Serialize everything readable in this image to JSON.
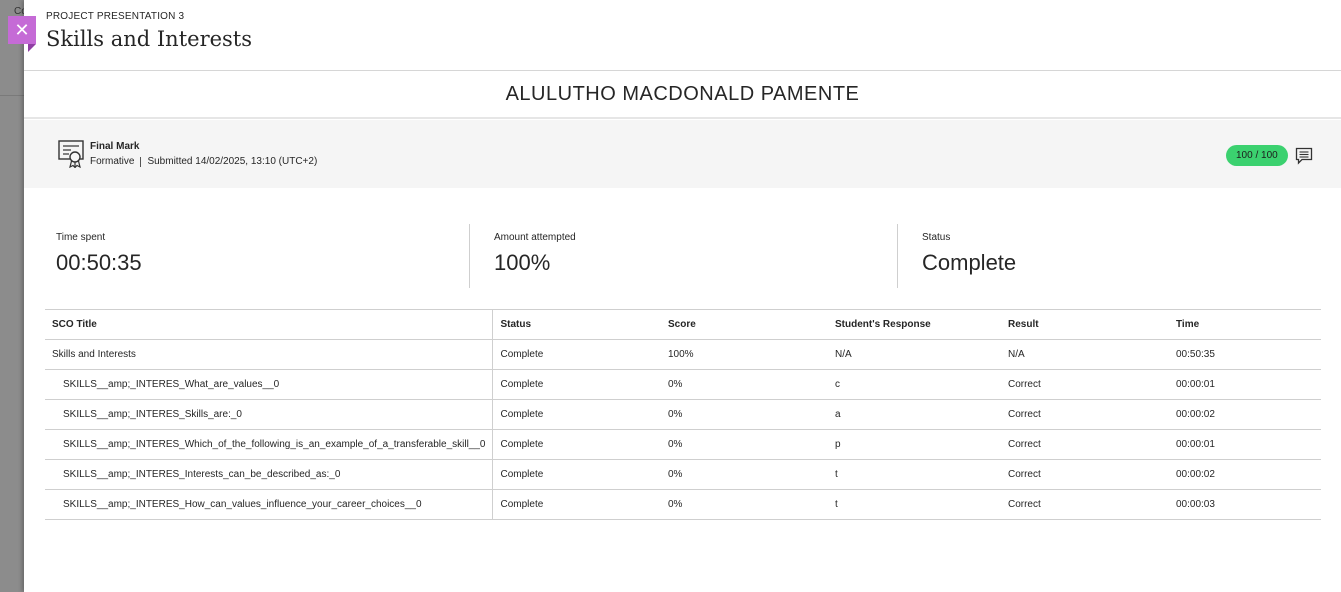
{
  "background": {
    "ghost_text": "Co"
  },
  "close_button": {
    "glyph": "✕"
  },
  "header": {
    "eyebrow": "PROJECT PRESENTATION 3",
    "title": "Skills and Interests"
  },
  "student_name": "ALULUTHO MACDONALD PAMENTE",
  "final_mark": {
    "title": "Final Mark",
    "type": "Formative",
    "submitted": "Submitted 14/02/2025, 13:10 (UTC+2)",
    "grade": "100 / 100",
    "grade_color": "#3bd16f"
  },
  "stats": [
    {
      "label": "Time spent",
      "value": "00:50:35"
    },
    {
      "label": "Amount attempted",
      "value": "100%"
    },
    {
      "label": "Status",
      "value": "Complete"
    }
  ],
  "table": {
    "headers": [
      "SCO Title",
      "Status",
      "Score",
      "Student's Response",
      "Result",
      "Time"
    ],
    "rows": [
      [
        "Skills and Interests",
        "Complete",
        "100%",
        "N/A",
        "N/A",
        "00:50:35"
      ],
      [
        "SKILLS__amp;_INTERES_What_are_values__0",
        "Complete",
        "0%",
        "c",
        "Correct",
        "00:00:01"
      ],
      [
        "SKILLS__amp;_INTERES_Skills_are:_0",
        "Complete",
        "0%",
        "a",
        "Correct",
        "00:00:02"
      ],
      [
        "SKILLS__amp;_INTERES_Which_of_the_following_is_an_example_of_a_transferable_skill__0",
        "Complete",
        "0%",
        "p",
        "Correct",
        "00:00:01"
      ],
      [
        "SKILLS__amp;_INTERES_Interests_can_be_described_as:_0",
        "Complete",
        "0%",
        "t",
        "Correct",
        "00:00:02"
      ],
      [
        "SKILLS__amp;_INTERES_How_can_values_influence_your_career_choices__0",
        "Complete",
        "0%",
        "t",
        "Correct",
        "00:00:03"
      ]
    ]
  },
  "icons": {
    "close": "close-icon",
    "certificate": "certificate-icon",
    "feedback": "feedback-icon"
  },
  "colors": {
    "accent": "#c56bd6",
    "grade_pill": "#3bd16f"
  }
}
